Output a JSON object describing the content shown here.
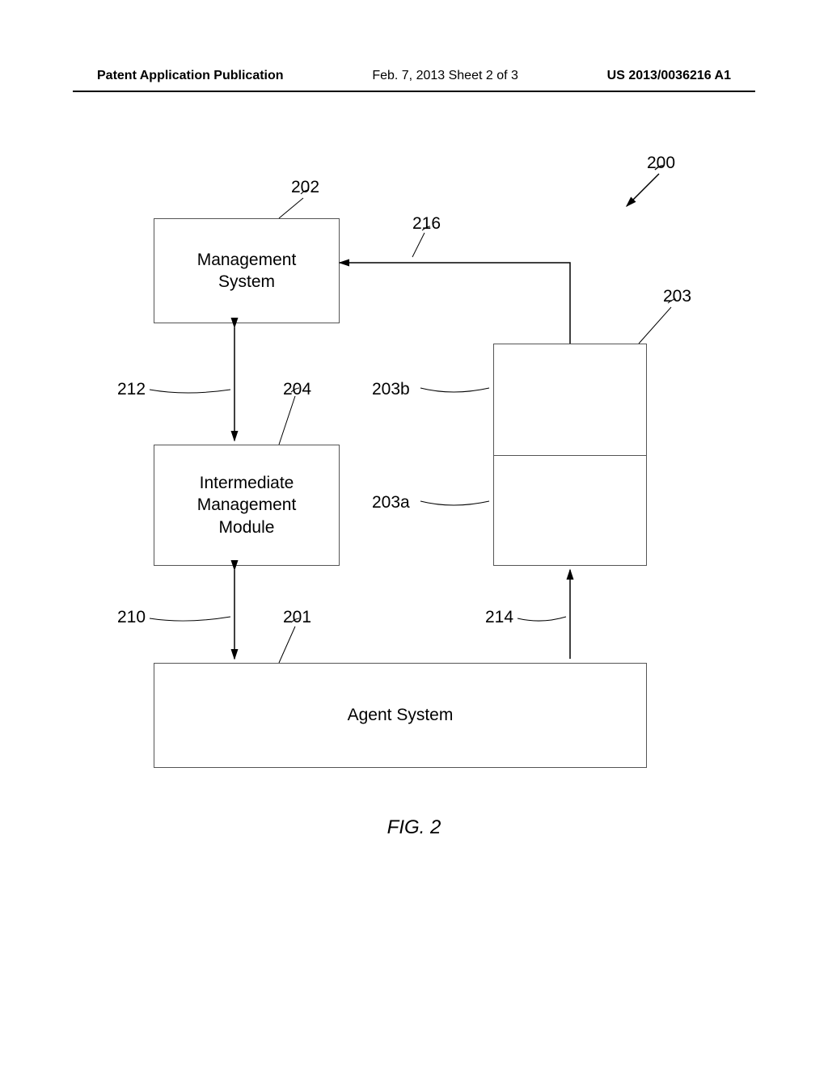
{
  "header": {
    "left": "Patent Application Publication",
    "center": "Feb. 7, 2013  Sheet 2 of 3",
    "right": "US 2013/0036216 A1"
  },
  "boxes": {
    "management_system": "Management\nSystem",
    "intermediate_module": "Intermediate\nManagement\nModule",
    "agent_system": "Agent System",
    "split_box_top": "",
    "split_box_bottom": ""
  },
  "labels": {
    "n200": "200",
    "n202": "202",
    "n216": "216",
    "n203": "203",
    "n212": "212",
    "n204": "204",
    "n203b": "203b",
    "n203a": "203a",
    "n210": "210",
    "n201": "201",
    "n214": "214"
  },
  "caption": "FIG. 2"
}
